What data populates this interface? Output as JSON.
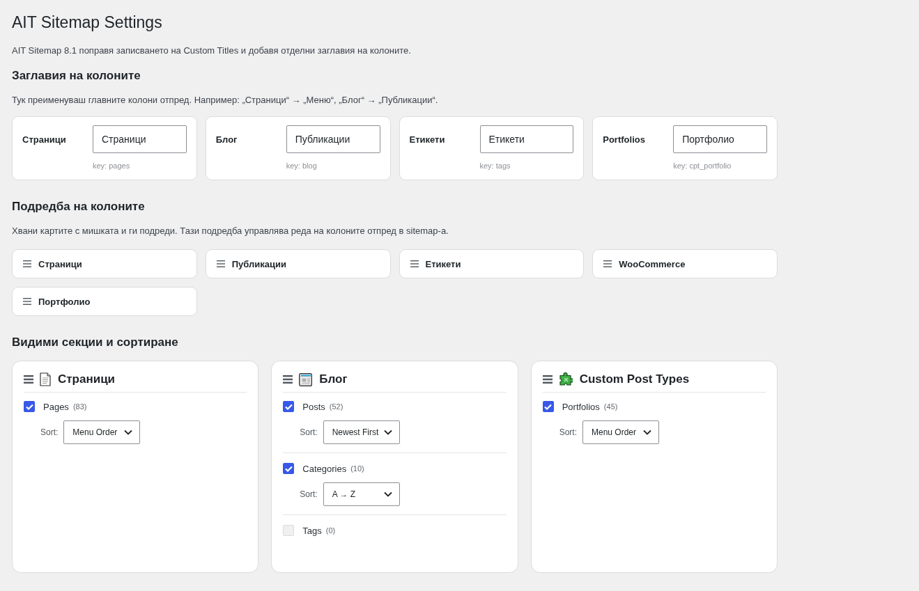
{
  "page": {
    "title": "AIT Sitemap Settings",
    "notice": "AIT Sitemap 8.1 поправя записването на Custom Titles и добавя отделни заглавия на колоните."
  },
  "column_titles": {
    "heading": "Заглавия на колоните",
    "description": "Тук преименуваш главните колони отпред. Например: „Страници“ → „Меню“, „Блог“ → „Публикации“.",
    "fields": [
      {
        "label": "Страници",
        "value": "Страници",
        "hint": "key: pages"
      },
      {
        "label": "Блог",
        "value": "Публикации",
        "hint": "key: blog"
      },
      {
        "label": "Етикети",
        "value": "Етикети",
        "hint": "key: tags"
      },
      {
        "label": "Portfolios",
        "value": "Портфолио",
        "hint": "key: cpt_portfolio"
      }
    ]
  },
  "column_order": {
    "heading": "Подредба на колоните",
    "description": "Хвани картите с мишката и ги подреди. Тази подредба управлява реда на колоните отпред в sitemap-а.",
    "items": [
      "Страници",
      "Публикации",
      "Етикети",
      "WooCommerce",
      "Портфолио"
    ]
  },
  "visible_sections": {
    "heading": "Видими секции и сортиране",
    "panels": [
      {
        "kind": "pages",
        "title": "Страници",
        "items": [
          {
            "label": "Pages",
            "count": "(83)",
            "checked": true,
            "sort": {
              "label": "Sort:",
              "value": "Menu Order"
            }
          }
        ]
      },
      {
        "kind": "blog",
        "title": "Блог",
        "items": [
          {
            "label": "Posts",
            "count": "(52)",
            "checked": true,
            "sort": {
              "label": "Sort:",
              "value": "Newest First"
            }
          },
          {
            "label": "Categories",
            "count": "(10)",
            "checked": true,
            "sort": {
              "label": "Sort:",
              "value": "A → Z"
            }
          },
          {
            "label": "Tags",
            "count": "(0)",
            "checked": false
          }
        ]
      },
      {
        "kind": "custom",
        "title": "Custom Post Types",
        "items": [
          {
            "label": "Portfolios",
            "count": "(45)",
            "checked": true,
            "sort": {
              "label": "Sort:",
              "value": "Menu Order"
            }
          }
        ]
      }
    ]
  }
}
